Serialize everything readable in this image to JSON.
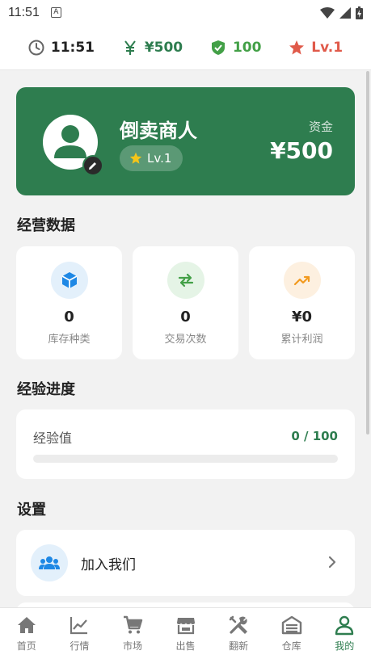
{
  "status_bar": {
    "time": "11:51",
    "notif_glyph": "A"
  },
  "top_bar": {
    "time": "11:51",
    "money": "¥500",
    "shield_value": "100",
    "level": "Lv.1",
    "colors": {
      "money": "#2e7d4f",
      "shield": "#43a047",
      "level": "#e05a4a"
    }
  },
  "profile": {
    "name": "倒卖商人",
    "level": "Lv.1",
    "funds_label": "资金",
    "funds_value": "¥500"
  },
  "sections": {
    "business": "经营数据",
    "experience": "经验进度",
    "settings": "设置"
  },
  "stats": [
    {
      "icon": "cube-icon",
      "value": "0",
      "label": "库存种类"
    },
    {
      "icon": "swap-icon",
      "value": "0",
      "label": "交易次数"
    },
    {
      "icon": "trend-up-icon",
      "value": "¥0",
      "label": "累计利润"
    }
  ],
  "experience": {
    "label": "经验值",
    "value": "0 / 100",
    "progress": 0
  },
  "settings": {
    "join_label": "加入我们"
  },
  "bottom_nav": [
    {
      "label": "首页",
      "icon": "home-icon"
    },
    {
      "label": "行情",
      "icon": "chart-icon"
    },
    {
      "label": "市场",
      "icon": "cart-icon"
    },
    {
      "label": "出售",
      "icon": "store-icon"
    },
    {
      "label": "翻新",
      "icon": "tools-icon"
    },
    {
      "label": "仓库",
      "icon": "warehouse-icon"
    },
    {
      "label": "我的",
      "icon": "person-icon",
      "active": true
    }
  ]
}
